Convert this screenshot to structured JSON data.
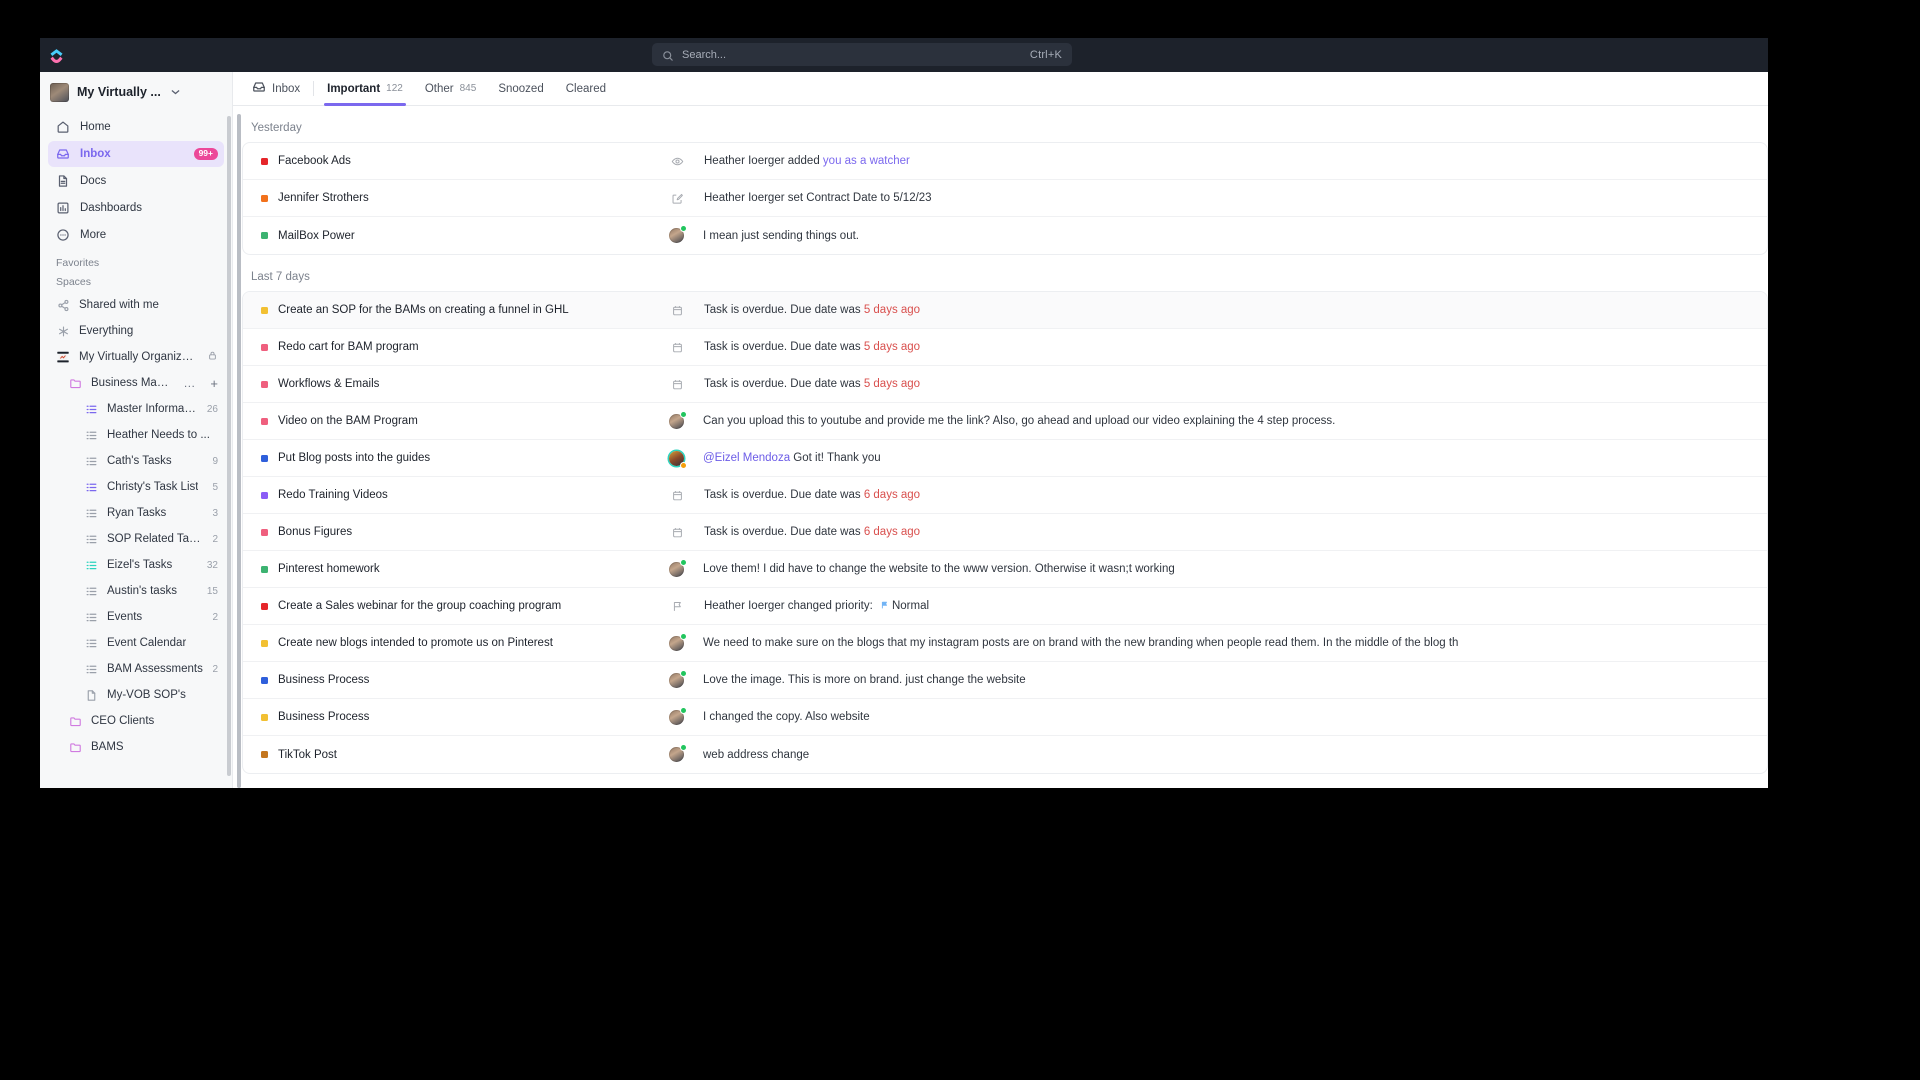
{
  "topbar": {
    "logo_icon": "clickup-logo-icon",
    "search": {
      "icon": "search-icon",
      "placeholder": "Search...",
      "shortcut": "Ctrl+K"
    }
  },
  "sidebar": {
    "workspace": {
      "name": "My Virtually ...",
      "avatar_icon": "workspace-avatar",
      "caret_icon": "chevron-down-icon"
    },
    "nav": [
      {
        "label": "Home",
        "icon": "home-icon",
        "active": false,
        "badge": ""
      },
      {
        "label": "Inbox",
        "icon": "inbox-icon",
        "active": true,
        "badge": "99+"
      },
      {
        "label": "Docs",
        "icon": "doc-icon",
        "active": false,
        "badge": ""
      },
      {
        "label": "Dashboards",
        "icon": "dashboard-icon",
        "active": false,
        "badge": ""
      },
      {
        "label": "More",
        "icon": "more-circle-icon",
        "active": false,
        "badge": ""
      }
    ],
    "favorites_label": "Favorites",
    "spaces_label": "Spaces",
    "tree": [
      {
        "label": "Shared with me",
        "icon": "share-icon",
        "level": 0,
        "count": ""
      },
      {
        "label": "Everything",
        "icon": "everything-icon",
        "level": 0,
        "count": ""
      },
      {
        "label": "My Virtually Organized B...",
        "icon": "space-avatar-icon",
        "level": 0,
        "count": "",
        "lock": true
      },
      {
        "label": "Business Managem...",
        "icon": "folder-icon",
        "level": 1,
        "count": "",
        "ellipsis": "…",
        "plus": "+"
      },
      {
        "label": "Master Information",
        "icon": "list-icon",
        "level": 2,
        "count": "26",
        "accent": "#7b68ee"
      },
      {
        "label": "Heather Needs to ...",
        "icon": "list-icon",
        "level": 2,
        "count": ""
      },
      {
        "label": "Cath's Tasks",
        "icon": "list-icon",
        "level": 2,
        "count": "9"
      },
      {
        "label": "Christy's Task List",
        "icon": "list-icon",
        "level": 2,
        "count": "5",
        "accent": "#7b68ee"
      },
      {
        "label": "Ryan Tasks",
        "icon": "list-icon",
        "level": 2,
        "count": "3"
      },
      {
        "label": "SOP Related Tasks",
        "icon": "list-icon",
        "level": 2,
        "count": "2"
      },
      {
        "label": "Eizel's Tasks",
        "icon": "list-icon",
        "level": 2,
        "count": "32",
        "accent": "#2dd4bf"
      },
      {
        "label": "Austin's tasks",
        "icon": "list-icon",
        "level": 2,
        "count": "15"
      },
      {
        "label": "Events",
        "icon": "list-icon",
        "level": 2,
        "count": "2"
      },
      {
        "label": "Event Calendar",
        "icon": "list-icon",
        "level": 2,
        "count": ""
      },
      {
        "label": "BAM Assessments",
        "icon": "list-icon",
        "level": 2,
        "count": "2"
      },
      {
        "label": "My-VOB SOP's",
        "icon": "doc-small-icon",
        "level": 2,
        "count": ""
      },
      {
        "label": "CEO Clients",
        "icon": "folder-icon",
        "level": 1,
        "count": ""
      },
      {
        "label": "BAMS",
        "icon": "folder-icon",
        "level": 1,
        "count": ""
      }
    ]
  },
  "tabs": [
    {
      "label": "Inbox",
      "count": "",
      "icon": "inbox-icon",
      "selected": false
    },
    {
      "label": "Important",
      "count": "122",
      "selected": true
    },
    {
      "label": "Other",
      "count": "845",
      "selected": false
    },
    {
      "label": "Snoozed",
      "count": "",
      "selected": false
    },
    {
      "label": "Cleared",
      "count": "",
      "selected": false
    }
  ],
  "groups": [
    {
      "title": "Yesterday",
      "rows": [
        {
          "dot": "#e5252a",
          "title": "Facebook Ads",
          "icon": "eye-icon",
          "msg_pre": "Heather Ioerger added ",
          "msg_link": "you as a watcher",
          "msg_post": ""
        },
        {
          "dot": "#f2711c",
          "title": "Jennifer Strothers",
          "icon": "edit-icon",
          "msg_pre": "Heather Ioerger set Contract Date to 5/12/23",
          "msg_link": "",
          "msg_post": ""
        },
        {
          "dot": "#3cb371",
          "title": "MailBox Power",
          "icon": "avatar",
          "msg_pre": "I mean just sending things out.",
          "msg_link": "",
          "msg_post": ""
        }
      ]
    },
    {
      "title": "Last 7 days",
      "rows": [
        {
          "dot": "#f2c032",
          "title": "Create an SOP for the BAMs on creating a funnel in GHL",
          "icon": "calendar-icon",
          "msg_pre": "Task is overdue. Due date was ",
          "msg_red": "5 days ago",
          "highlight": true
        },
        {
          "dot": "#ef5f7e",
          "title": "Redo cart for BAM program",
          "icon": "calendar-icon",
          "msg_pre": "Task is overdue. Due date was ",
          "msg_red": "5 days ago"
        },
        {
          "dot": "#ef5f7e",
          "title": "Workflows & Emails",
          "icon": "calendar-icon",
          "msg_pre": "Task is overdue. Due date was ",
          "msg_red": "5 days ago"
        },
        {
          "dot": "#ef5f7e",
          "title": "Video on the BAM Program",
          "icon": "avatar",
          "msg_pre": "Can you upload this to youtube and provide me the link? Also, go ahead and upload our video explaining the 4 step process."
        },
        {
          "dot": "#2f5fdb",
          "title": "Put Blog posts into the guides",
          "icon": "avatar-b",
          "msg_mention": "@Eizel Mendoza",
          "msg_pre": " Got it! Thank you"
        },
        {
          "dot": "#8b5cf6",
          "title": "Redo Training Videos",
          "icon": "calendar-icon",
          "msg_pre": "Task is overdue. Due date was ",
          "msg_red": "6 days ago"
        },
        {
          "dot": "#ef5f7e",
          "title": "Bonus Figures",
          "icon": "calendar-icon",
          "msg_pre": "Task is overdue. Due date was ",
          "msg_red": "6 days ago"
        },
        {
          "dot": "#3cb371",
          "title": "Pinterest homework",
          "icon": "avatar",
          "msg_pre": "Love them! I did have to change the website to the www version. Otherwise it wasn;t working"
        },
        {
          "dot": "#e5252a",
          "title": "Create a Sales webinar for the group coaching program",
          "icon": "flag-icon",
          "msg_pre": "Heather Ioerger changed priority: ",
          "msg_priority": "Normal",
          "priority_color": "#72b4f5"
        },
        {
          "dot": "#f2c032",
          "title": "Create new blogs intended to promote us on Pinterest",
          "icon": "avatar",
          "msg_pre": "We need to make sure on the blogs that my instagram posts are on brand with the new branding when people read them. In the middle of the blog th"
        },
        {
          "dot": "#2f5fdb",
          "title": "Business Process",
          "icon": "avatar",
          "msg_pre": "Love the image. This is more on brand. just change the website"
        },
        {
          "dot": "#f2c032",
          "title": "Business Process",
          "icon": "avatar",
          "msg_pre": "I changed the copy. Also website"
        },
        {
          "dot": "#c4761e",
          "title": "TikTok Post",
          "icon": "avatar",
          "msg_pre": "web address change"
        }
      ]
    }
  ]
}
